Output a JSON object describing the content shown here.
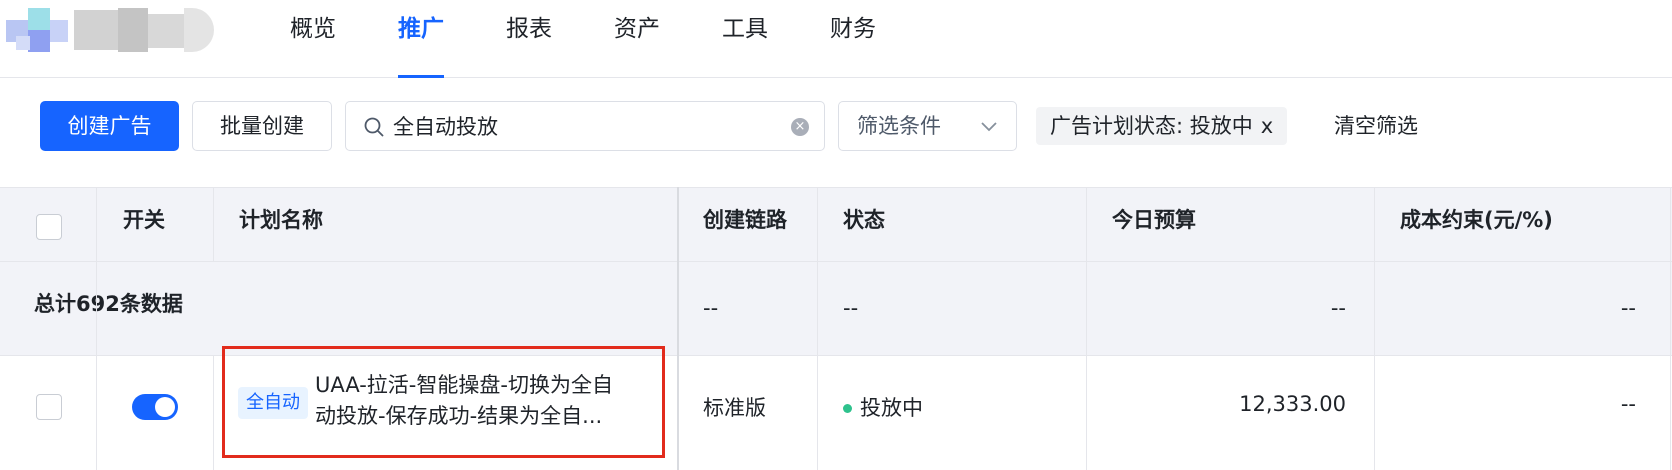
{
  "colors": {
    "accent": "#1664ff",
    "highlight_border": "#e22b1c",
    "status_active": "#2ec28d",
    "tag_bg": "#e8f3ff"
  },
  "nav": {
    "items": [
      {
        "label": "概览",
        "active": false
      },
      {
        "label": "推广",
        "active": true
      },
      {
        "label": "报表",
        "active": false
      },
      {
        "label": "资产",
        "active": false
      },
      {
        "label": "工具",
        "active": false
      },
      {
        "label": "财务",
        "active": false
      }
    ]
  },
  "toolbar": {
    "create_label": "创建广告",
    "batch_label": "批量创建",
    "search_value": "全自动投放",
    "filter_label": "筛选条件",
    "active_filter_label": "广告计划状态: 投放中",
    "active_filter_remove": "x",
    "clear_filters_label": "清空筛选"
  },
  "table": {
    "columns": {
      "toggle": "开关",
      "name": "计划名称",
      "path": "创建链路",
      "status": "状态",
      "budget": "今日预算",
      "cost": "成本约束(元/%)"
    },
    "summary": {
      "label": "总计692条数据",
      "path": "--",
      "status": "--",
      "budget": "--",
      "cost": "--"
    },
    "rows": [
      {
        "toggle_on": true,
        "badge": "全自动",
        "name_line1": "UAA-拉活-智能操盘-切换为全自",
        "name_line2": "动投放-保存成功-结果为全自...",
        "path": "标准版",
        "status": "投放中",
        "budget": "12,333.00",
        "cost": "--"
      }
    ]
  }
}
